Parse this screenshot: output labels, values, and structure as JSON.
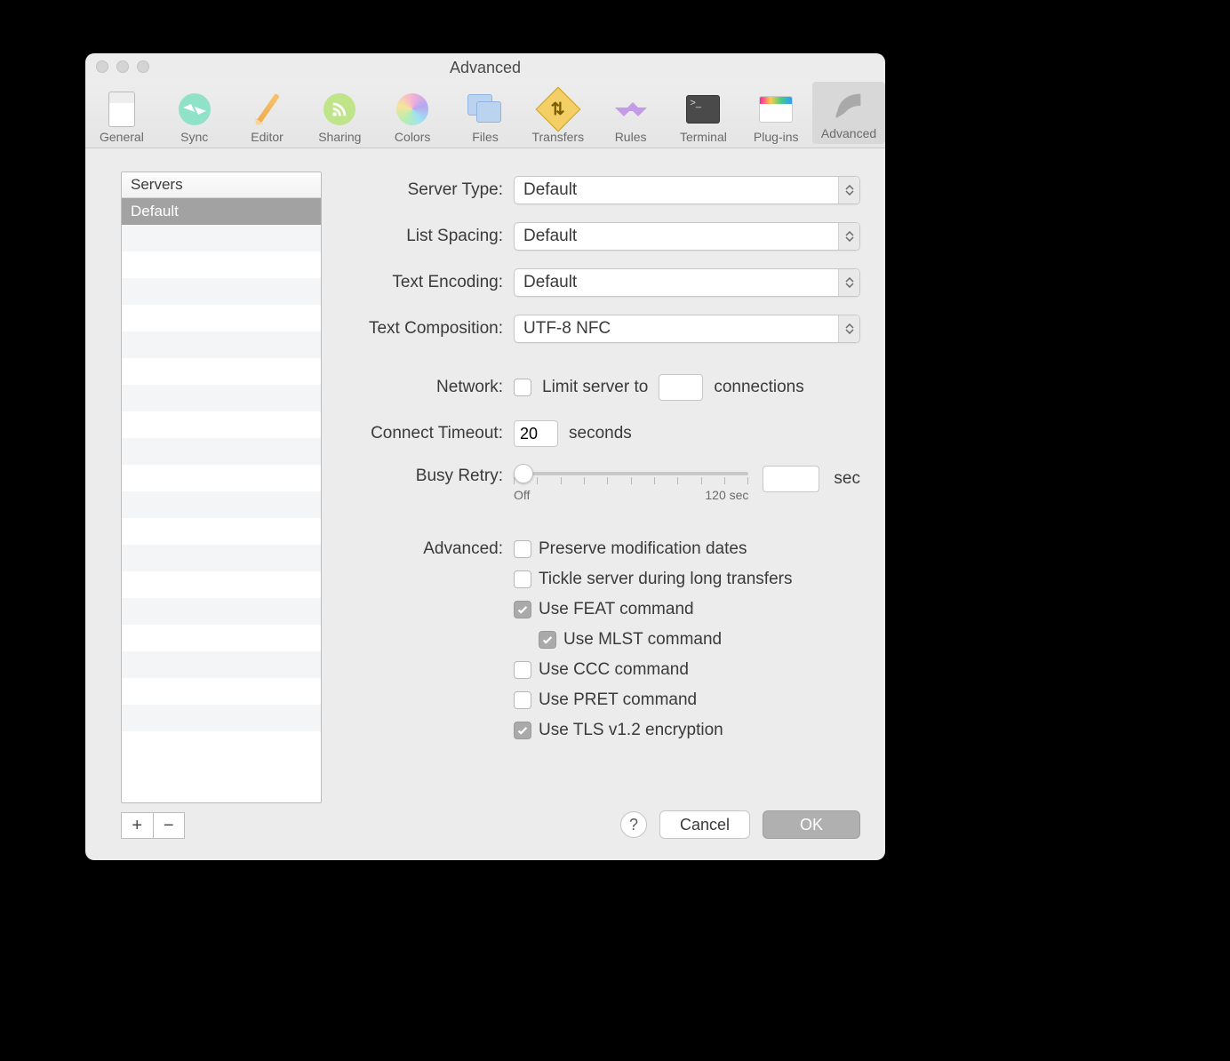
{
  "window_title": "Advanced",
  "toolbar": [
    {
      "label": "General"
    },
    {
      "label": "Sync"
    },
    {
      "label": "Editor"
    },
    {
      "label": "Sharing"
    },
    {
      "label": "Colors"
    },
    {
      "label": "Files"
    },
    {
      "label": "Transfers"
    },
    {
      "label": "Rules"
    },
    {
      "label": "Terminal"
    },
    {
      "label": "Plug-ins"
    },
    {
      "label": "Advanced"
    }
  ],
  "sidebar": {
    "header": "Servers",
    "items": [
      "Default"
    ]
  },
  "buttons": {
    "add": "+",
    "remove": "−",
    "help": "?",
    "cancel": "Cancel",
    "ok": "OK"
  },
  "labels": {
    "server_type": "Server Type:",
    "list_spacing": "List Spacing:",
    "text_encoding": "Text Encoding:",
    "text_composition": "Text Composition:",
    "network": "Network:",
    "connect_timeout": "Connect Timeout:",
    "busy_retry": "Busy Retry:",
    "advanced": "Advanced:",
    "limit_server_to": "Limit server to",
    "connections": "connections",
    "seconds": "seconds",
    "sec": "sec",
    "slider_off": "Off",
    "slider_max": "120 sec"
  },
  "values": {
    "server_type": "Default",
    "list_spacing": "Default",
    "text_encoding": "Default",
    "text_composition": "UTF-8 NFC",
    "limit_checked": false,
    "limit_value": "",
    "connect_timeout": "20",
    "busy_retry_value": ""
  },
  "adv": {
    "preserve": {
      "label": "Preserve modification dates",
      "checked": false
    },
    "tickle": {
      "label": "Tickle server during long transfers",
      "checked": false
    },
    "feat": {
      "label": "Use FEAT command",
      "checked": true
    },
    "mlst": {
      "label": "Use MLST command",
      "checked": true
    },
    "ccc": {
      "label": "Use CCC command",
      "checked": false
    },
    "pret": {
      "label": "Use PRET command",
      "checked": false
    },
    "tls": {
      "label": "Use TLS v1.2 encryption",
      "checked": true
    }
  }
}
